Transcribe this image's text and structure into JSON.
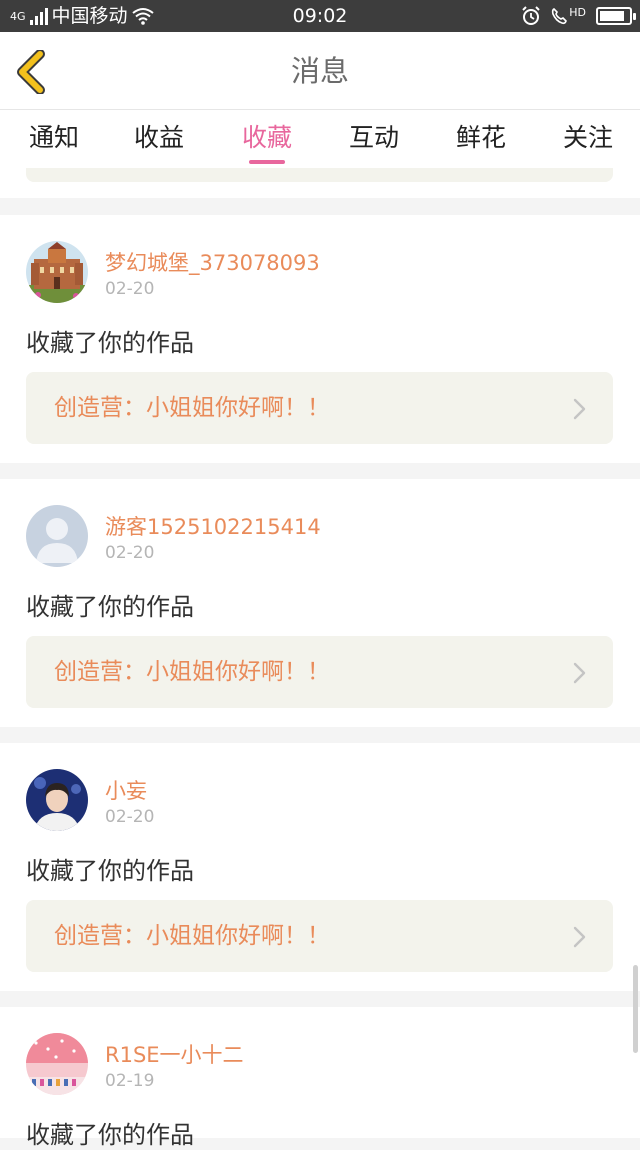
{
  "status_bar": {
    "network": "4G",
    "carrier": "中国移动",
    "time": "09:02",
    "hd_label": "HD",
    "battery_level": 0.85
  },
  "nav": {
    "title": "消息",
    "back_icon": "chevron-left-icon",
    "back_color": "#f3c11d"
  },
  "tabs": [
    {
      "label": "通知"
    },
    {
      "label": "收益"
    },
    {
      "label": "收藏",
      "active": true
    },
    {
      "label": "互动"
    },
    {
      "label": "鲜花"
    },
    {
      "label": "关注"
    }
  ],
  "accent_color": "#e8679d",
  "items": [
    {
      "user": "梦幻城堡_373078093",
      "date": "02-20",
      "action": "收藏了你的作品",
      "work": "创造营：小姐姐你好啊！！",
      "avatar": "castle-avatar"
    },
    {
      "user": "游客1525102215414",
      "date": "02-20",
      "action": "收藏了你的作品",
      "work": "创造营：小姐姐你好啊！！",
      "avatar": "default-avatar"
    },
    {
      "user": "小妄",
      "date": "02-20",
      "action": "收藏了你的作品",
      "work": "创造营：小姐姐你好啊！！",
      "avatar": "person-avatar"
    },
    {
      "user": "R1SE一小十二",
      "date": "02-19",
      "action": "收藏了你的作品",
      "avatar": "pink-avatar"
    }
  ]
}
